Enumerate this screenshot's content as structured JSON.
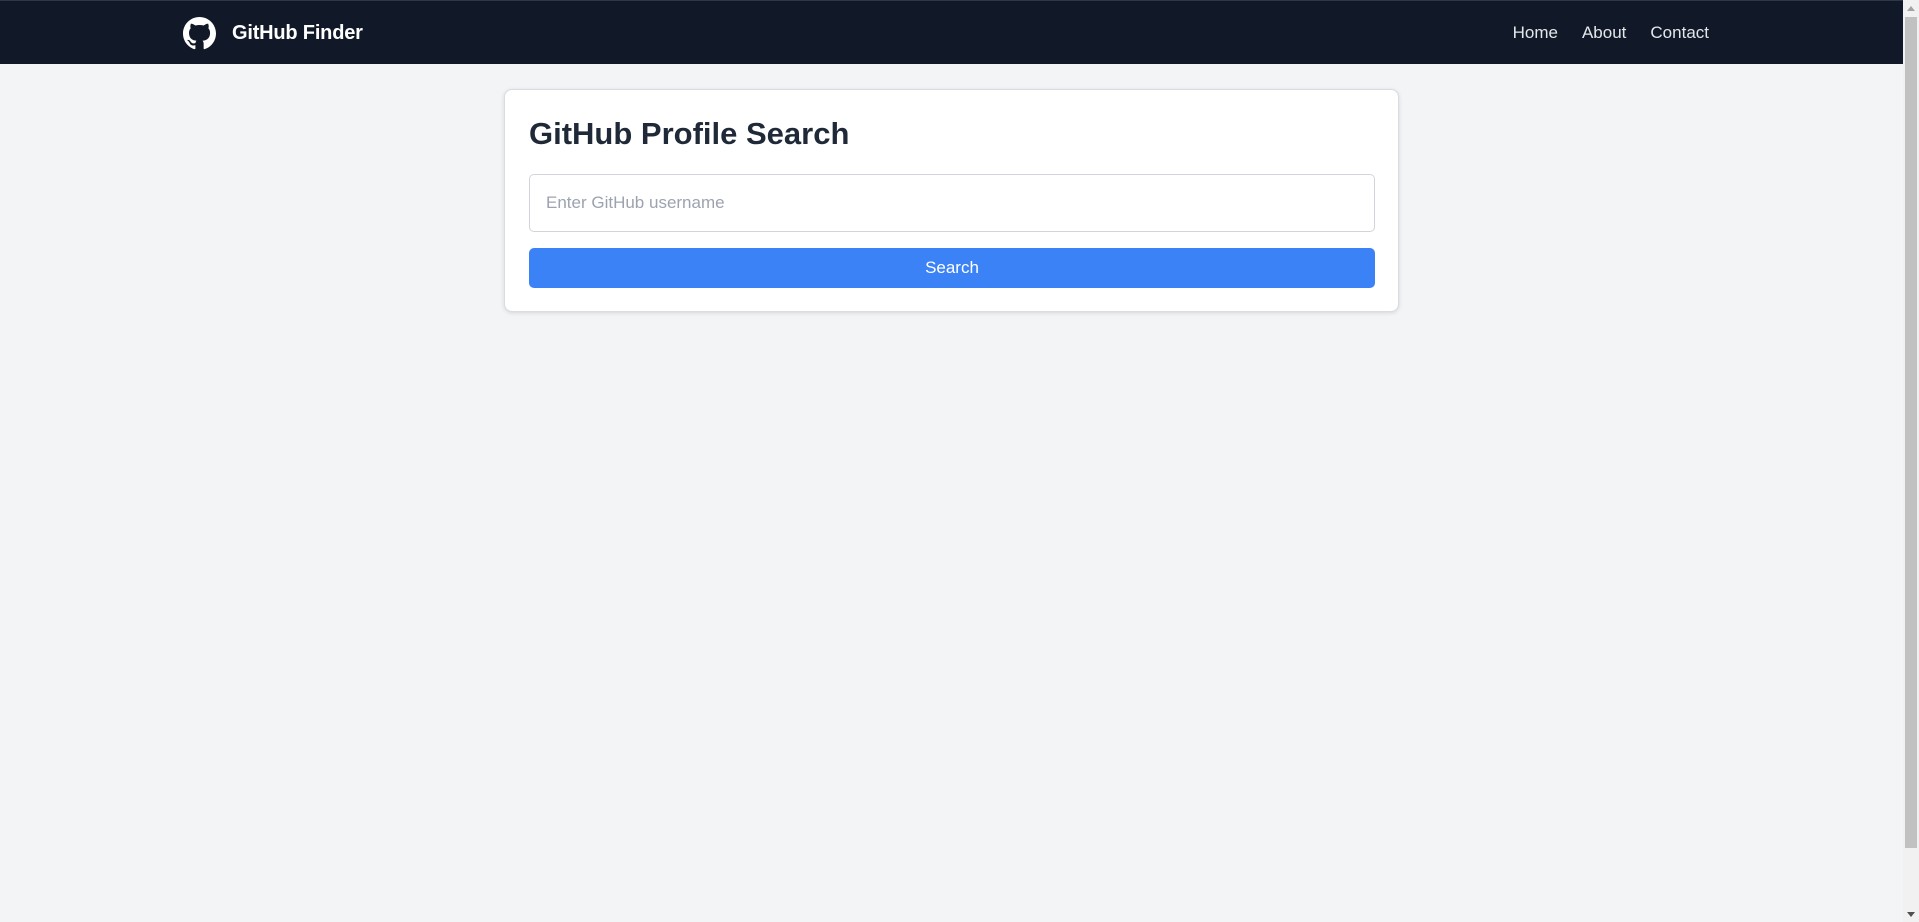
{
  "navbar": {
    "brand": "GitHub Finder",
    "brand_icon": "github-logo-icon",
    "links": [
      "Home",
      "About",
      "Contact"
    ]
  },
  "search_card": {
    "title": "GitHub Profile Search",
    "input_value": "",
    "input_placeholder": "Enter GitHub username",
    "button_label": "Search"
  },
  "colors": {
    "navbar_background": "#111827",
    "page_background": "#f3f4f6",
    "button_background": "#3b82f6",
    "title_text": "#1f2937"
  }
}
